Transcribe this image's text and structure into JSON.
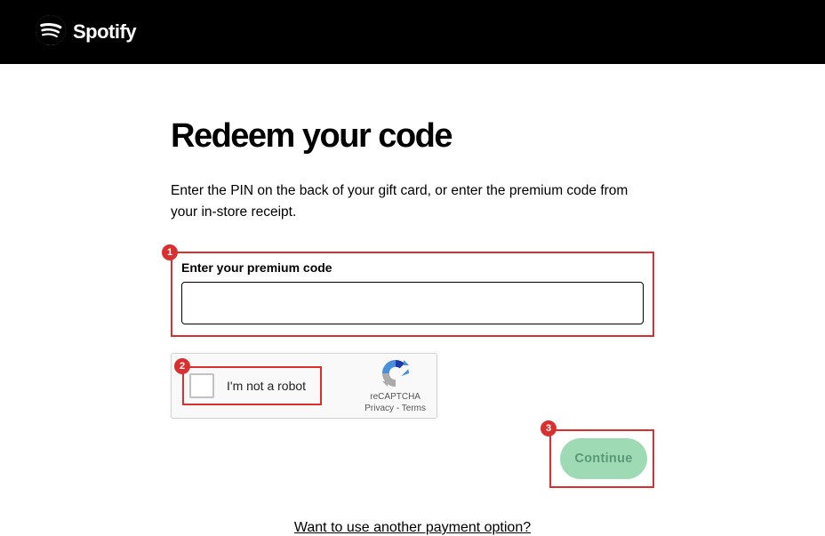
{
  "header": {
    "brand": "Spotify"
  },
  "page": {
    "title": "Redeem your code",
    "description": "Enter the PIN on the back of your gift card, or enter the premium code from your in-store receipt."
  },
  "form": {
    "code_label": "Enter your premium code",
    "code_value": "",
    "continue_label": "Continue"
  },
  "recaptcha": {
    "checkbox_label": "I'm not a robot",
    "brand": "reCAPTCHA",
    "privacy": "Privacy",
    "separator": " - ",
    "terms": "Terms"
  },
  "alt_payment": {
    "link_text": "Want to use another payment option?"
  },
  "annotations": {
    "a1": "1",
    "a2": "2",
    "a3": "3"
  }
}
